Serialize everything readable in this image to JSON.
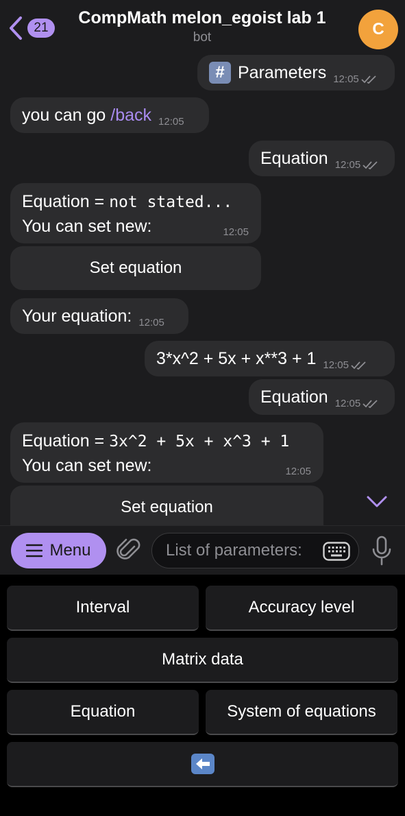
{
  "header": {
    "back_count": "21",
    "title": "CompMath melon_egoist lab 1",
    "subtitle": "bot",
    "avatar_letter": "C",
    "avatar_color": "#f2a23c"
  },
  "messages": {
    "m1": {
      "text": "Parameters",
      "time": "12:05"
    },
    "m2": {
      "text": "you can go ",
      "command": "/back",
      "time": "12:05"
    },
    "m3": {
      "text": "Equation",
      "time": "12:05"
    },
    "m4": {
      "prefix": "Equation = ",
      "value": "not stated...",
      "line2": "You can set new:",
      "time": "12:05"
    },
    "m4_button": "Set equation",
    "m5": {
      "text": "Your equation:",
      "time": "12:05"
    },
    "m6": {
      "text": "3*x^2 + 5x + x**3 + 1",
      "time": "12:05"
    },
    "m7": {
      "text": "Equation",
      "time": "12:05"
    },
    "m8": {
      "prefix": "Equation = ",
      "value": "3x^2 + 5x + x^3 + 1",
      "line2": "You can set new:",
      "time": "12:05"
    },
    "m8_button": "Set equation"
  },
  "input_bar": {
    "menu_label": "Menu",
    "placeholder": "List of parameters:"
  },
  "keyboard": {
    "interval": "Interval",
    "accuracy": "Accuracy level",
    "matrix": "Matrix data",
    "equation": "Equation",
    "system": "System of equations"
  },
  "colors": {
    "accent": "#b090f0",
    "bubble": "#2c2c2e",
    "background": "#1c1c1e"
  }
}
